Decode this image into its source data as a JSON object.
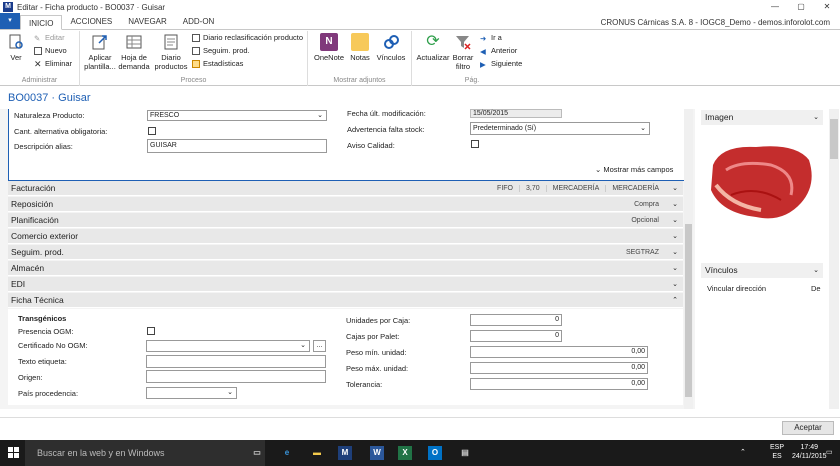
{
  "window": {
    "title": "Editar - Ficha producto - BO0037 · Guisar",
    "min": "—",
    "max": "▢",
    "close": "✕"
  },
  "tabs": [
    "INICIO",
    "ACCIONES",
    "NAVEGAR",
    "ADD-ON"
  ],
  "company": "CRONUS Cárnicas S.A. 8 - IOGC8_Demo - demos.inforolot.com",
  "ribbon": {
    "admin": {
      "label": "Administrar",
      "ver": "Ver",
      "editar": "Editar",
      "nuevo": "Nuevo",
      "eliminar": "Eliminar"
    },
    "proceso": {
      "label": "Proceso",
      "aplicar": "Aplicar plantilla...",
      "hoja": "Hoja de demanda",
      "diario": "Diario productos",
      "reclasif": "Diario reclasificación producto",
      "seguim": "Seguim. prod.",
      "estad": "Estadísticas"
    },
    "adjuntos": {
      "label": "Mostrar adjuntos",
      "onenote": "OneNote",
      "notas": "Notas",
      "vinculos": "Vínculos"
    },
    "pag": {
      "label": "Pág.",
      "actualizar": "Actualizar",
      "borrar": "Borrar filtro",
      "ira": "Ir a",
      "anterior": "Anterior",
      "siguiente": "Siguiente"
    }
  },
  "page_title": "BO0037 · Guisar",
  "general": {
    "naturaleza_label": "Naturaleza Producto:",
    "naturaleza_value": "FRESCO",
    "cant_alt_label": "Cant. alternativa obligatoria:",
    "desc_alias_label": "Descripción alias:",
    "desc_alias_value": "GUISAR",
    "fecha_label": "Fecha últ. modificación:",
    "fecha_value": "15/05/2015",
    "advert_label": "Advertencia falta stock:",
    "advert_value": "Predeterminado (Sí)",
    "aviso_label": "Aviso Calidad:",
    "mostrar_mas": "Mostrar más campos"
  },
  "fasttabs": [
    {
      "name": "Facturación",
      "summary": [
        "FIFO",
        "3,70",
        "MERCADERÍA",
        "MERCADERÍA"
      ]
    },
    {
      "name": "Reposición",
      "summary": [
        "Compra"
      ]
    },
    {
      "name": "Planificación",
      "summary": [
        "Opcional"
      ]
    },
    {
      "name": "Comercio exterior",
      "summary": []
    },
    {
      "name": "Seguim. prod.",
      "summary": [
        "SEGTRAZ"
      ]
    },
    {
      "name": "Almacén",
      "summary": []
    },
    {
      "name": "EDI",
      "summary": []
    },
    {
      "name": "Ficha Técnica",
      "summary": []
    }
  ],
  "ficha": {
    "section": "Transgénicos",
    "presencia": "Presencia OGM:",
    "certificado": "Certificado No OGM:",
    "texto": "Texto etiqueta:",
    "origen": "Origen:",
    "pais": "País procedencia:",
    "uds_caja_label": "Unidades por Caja:",
    "uds_caja": "0",
    "cajas_palet_label": "Cajas por Palet:",
    "cajas_palet": "0",
    "peso_min_label": "Peso mín. unidad:",
    "peso_min": "0,00",
    "peso_max_label": "Peso máx. unidad:",
    "peso_max": "0,00",
    "tol_label": "Tolerancia:",
    "tol": "0,00",
    "lookup_btn": "..."
  },
  "factbox": {
    "imagen": "Imagen",
    "vinculos": "Vínculos",
    "vinc_dir": "Vincular dirección",
    "vinc_de": "De"
  },
  "accept": "Aceptar",
  "taskbar": {
    "search": "Buscar en la web y en Windows",
    "lang1": "ESP",
    "lang2": "ES",
    "time": "17:49",
    "date": "24/11/2015"
  }
}
